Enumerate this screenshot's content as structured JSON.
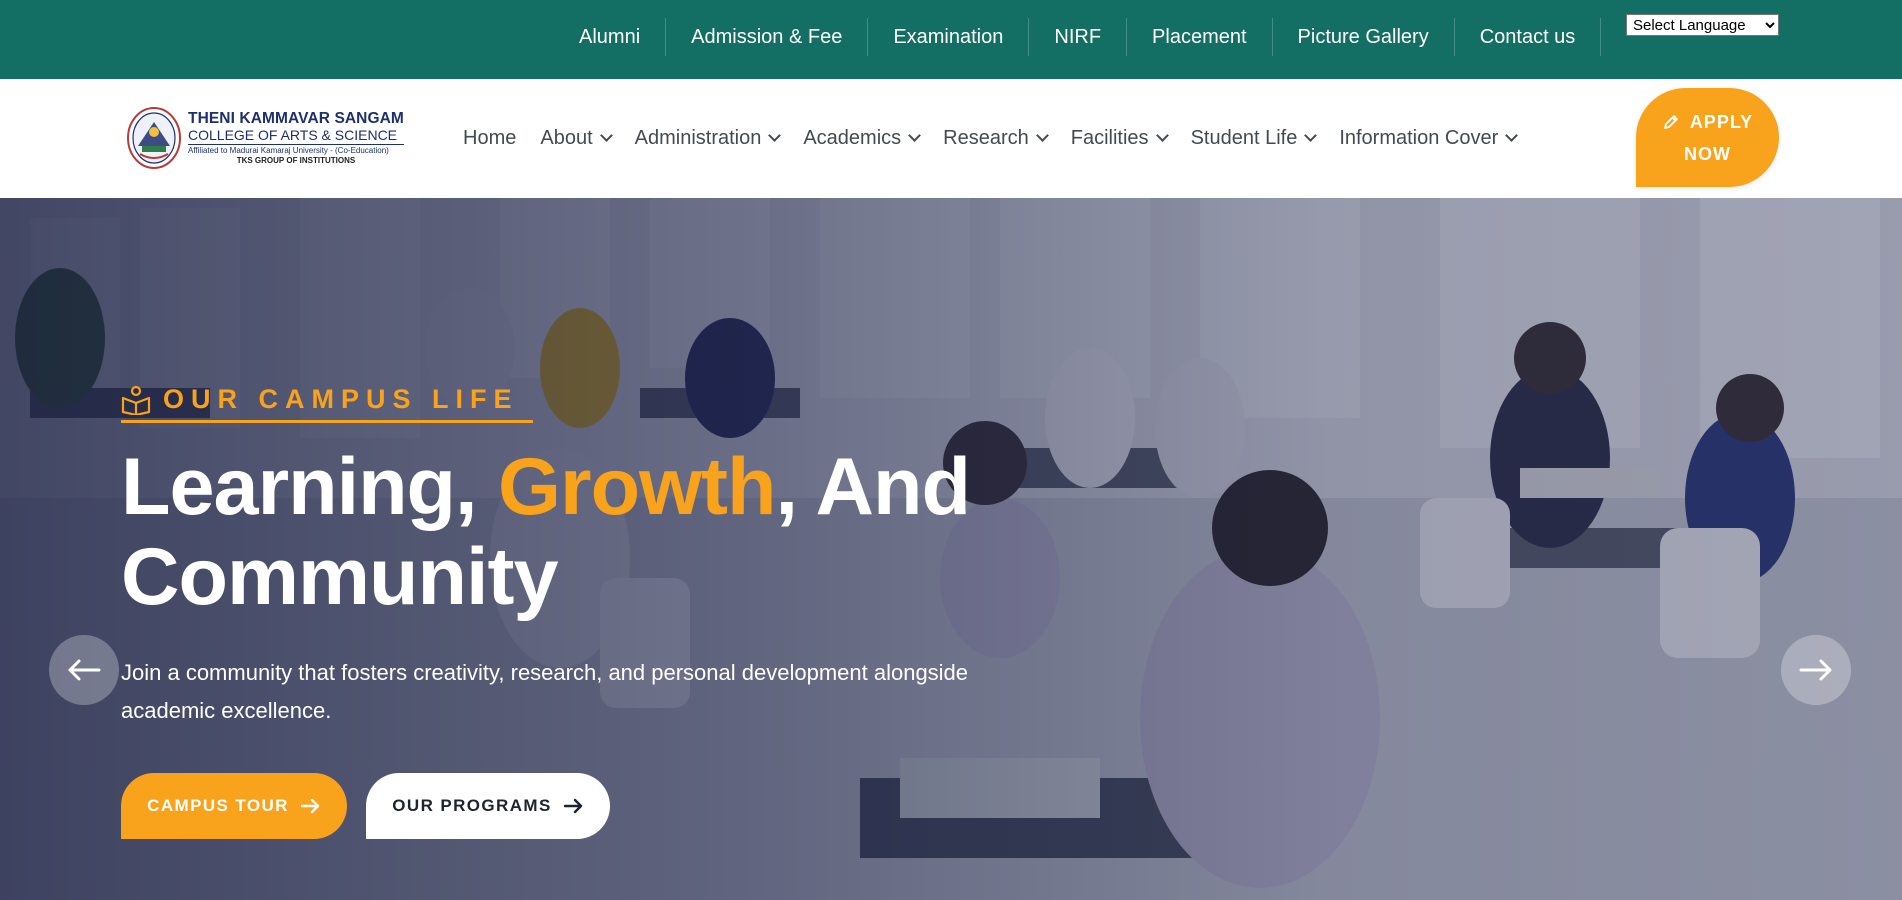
{
  "topbar": {
    "links": [
      "Alumni",
      "Admission & Fee",
      "Examination",
      "NIRF",
      "Placement",
      "Picture Gallery",
      "Contact us"
    ],
    "language_select": "Select Language"
  },
  "logo": {
    "line1": "THENI KAMMAVAR SANGAM",
    "line2": "COLLEGE OF ARTS & SCIENCE",
    "line3": "Affiliated to Madurai Kamaraj University - (Co-Education)",
    "line4": "TKS GROUP OF INSTITUTIONS"
  },
  "mainnav": {
    "items": [
      {
        "label": "Home",
        "has_dropdown": false
      },
      {
        "label": "About",
        "has_dropdown": true
      },
      {
        "label": "Administration",
        "has_dropdown": true
      },
      {
        "label": "Academics",
        "has_dropdown": true
      },
      {
        "label": "Research",
        "has_dropdown": true
      },
      {
        "label": "Facilities",
        "has_dropdown": true
      },
      {
        "label": "Student Life",
        "has_dropdown": true
      },
      {
        "label": "Information Cover",
        "has_dropdown": true
      }
    ],
    "apply_line1": "APPLY",
    "apply_line2": "NOW",
    "apply_icon": "pencil-icon"
  },
  "hero": {
    "eyebrow_icon": "open-book-icon",
    "eyebrow": "OUR CAMPUS LIFE",
    "headline_part1": "Learning, ",
    "headline_accent": "Growth",
    "headline_part2": ", And",
    "headline_line2": "Community",
    "description_line1": "Join a community that fosters creativity, research, and personal development alongside",
    "description_line2": "academic excellence.",
    "button_primary": "CAMPUS TOUR",
    "button_secondary": "OUR PROGRAMS",
    "prev_icon": "arrow-left-icon",
    "next_icon": "arrow-right-icon"
  },
  "colors": {
    "topbar_bg": "#136e63",
    "accent": "#f9a21b",
    "nav_text": "#444a52",
    "logo_blue": "#1d2f6f"
  }
}
